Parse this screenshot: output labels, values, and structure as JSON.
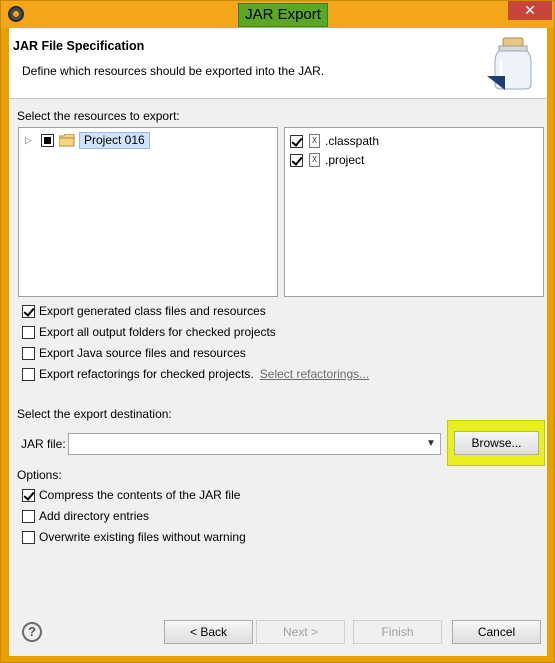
{
  "window": {
    "title": "JAR Export",
    "close_glyph": "✕"
  },
  "banner": {
    "title": "JAR File Specification",
    "description": "Define which resources should be exported into the JAR."
  },
  "resources": {
    "label": "Select the resources to export:",
    "tree": [
      {
        "label": "Project 016",
        "state": "partial"
      }
    ],
    "files": [
      {
        "label": ".classpath",
        "checked": true
      },
      {
        "label": ".project",
        "checked": true
      }
    ]
  },
  "export_options": [
    {
      "label": "Export generated class files and resources",
      "checked": true
    },
    {
      "label": "Export all output folders for checked projects",
      "checked": false
    },
    {
      "label": "Export Java source files and resources",
      "checked": false
    },
    {
      "label": "Export refactorings for checked projects.",
      "checked": false
    }
  ],
  "select_refactorings_link": "Select refactorings...",
  "destination": {
    "label": "Select the export destination:",
    "jar_file_label": "JAR file:",
    "jar_file_value": "",
    "browse_label": "Browse..."
  },
  "options": {
    "label": "Options:",
    "items": [
      {
        "label": "Compress the contents of the JAR file",
        "checked": true
      },
      {
        "label": "Add directory entries",
        "checked": false
      },
      {
        "label": "Overwrite existing files without warning",
        "checked": false
      }
    ]
  },
  "buttons": {
    "back": "< Back",
    "next": "Next >",
    "finish": "Finish",
    "cancel": "Cancel",
    "help_glyph": "?"
  },
  "colors": {
    "title_highlight": "#5aa726",
    "browse_highlight": "#eaf01e",
    "window_frame": "#f4a61a"
  }
}
